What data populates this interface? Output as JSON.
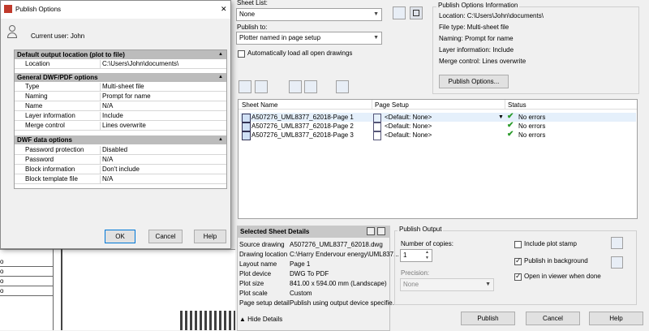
{
  "dialog": {
    "title": "Publish Options",
    "close_glyph": "✕",
    "current_user": "Current user: John",
    "sections": [
      {
        "title": "Default output location (plot to file)",
        "rows": [
          {
            "key": "Location",
            "value": "C:\\Users\\John\\documents\\"
          }
        ]
      },
      {
        "title": "General DWF/PDF options",
        "rows": [
          {
            "key": "Type",
            "value": "Multi-sheet file"
          },
          {
            "key": "Naming",
            "value": "Prompt for name"
          },
          {
            "key": "Name",
            "value": "N/A"
          },
          {
            "key": "Layer information",
            "value": "Include"
          },
          {
            "key": "Merge control",
            "value": "Lines overwrite"
          }
        ]
      },
      {
        "title": "DWF data options",
        "rows": [
          {
            "key": "Password protection",
            "value": "Disabled"
          },
          {
            "key": "Password",
            "value": "N/A"
          },
          {
            "key": "Block information",
            "value": "Don't include"
          },
          {
            "key": "Block template file",
            "value": "N/A"
          }
        ]
      }
    ],
    "ok": "OK",
    "cancel": "Cancel",
    "help": "Help"
  },
  "background_left": {
    "cells": [
      "o",
      "o",
      "o",
      "o"
    ]
  },
  "publish": {
    "sheet_list_label": "Sheet List:",
    "sheet_list_value": "None",
    "publish_to_label": "Publish to:",
    "publish_to_value": "Plotter named in page setup",
    "auto_load_label": "Automatically load all open drawings",
    "info": {
      "title": "Publish Options Information",
      "lines": [
        "Location:  C:\\Users\\John\\documents\\",
        "File type:  Multi-sheet file",
        "Naming:  Prompt for name",
        "Layer information:  Include",
        "Merge control:  Lines overwrite"
      ],
      "button": "Publish Options..."
    },
    "table": {
      "headers": [
        "Sheet Name",
        "Page Setup",
        "Status"
      ],
      "rows": [
        {
          "name": "A507276_UML8377_62018-Page 1",
          "setup": "<Default: None>",
          "status": "No errors"
        },
        {
          "name": "A507276_UML8377_62018-Page 2",
          "setup": "<Default: None>",
          "status": "No errors"
        },
        {
          "name": "A507276_UML8377_62018-Page 3",
          "setup": "<Default: None>",
          "status": "No errors"
        }
      ]
    },
    "details": {
      "title": "Selected Sheet Details",
      "rows": [
        {
          "key": "Source drawing",
          "value": "A507276_UML8377_62018.dwg"
        },
        {
          "key": "Drawing location",
          "value": "C:\\Harry Endervour energy\\UML837..."
        },
        {
          "key": "Layout name",
          "value": "Page 1"
        },
        {
          "key": "Plot device",
          "value": "DWG To PDF"
        },
        {
          "key": "Plot size",
          "value": "841.00 x 594.00 mm (Landscape)"
        },
        {
          "key": "Plot scale",
          "value": "Custom"
        },
        {
          "key": "Page setup detail",
          "value": "Publish using output device specifie..."
        }
      ],
      "hide": "Hide Details"
    },
    "output": {
      "title": "Publish Output",
      "copies_label": "Number of copies:",
      "copies_value": "1",
      "precision_label": "Precision:",
      "precision_value": "None",
      "plot_stamp": "Include plot stamp",
      "background": "Publish in background",
      "viewer": "Open in viewer when done"
    },
    "publish_btn": "Publish",
    "cancel_btn": "Cancel",
    "help_btn": "Help"
  }
}
